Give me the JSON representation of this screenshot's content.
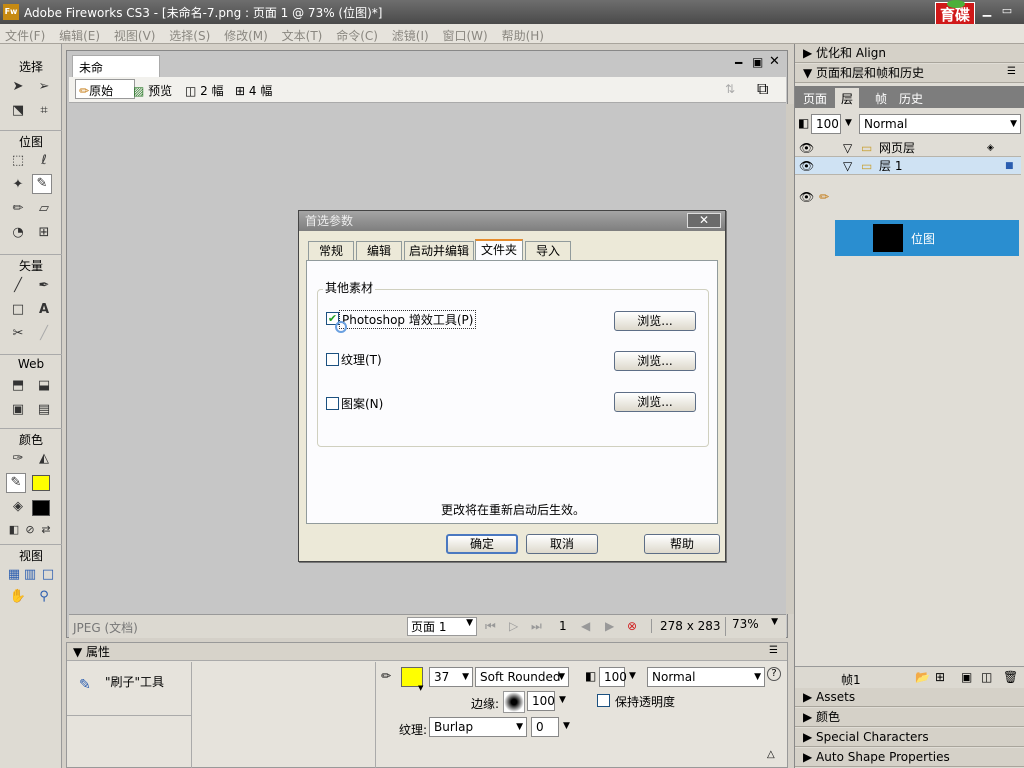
{
  "window": {
    "title": "Adobe Fireworks CS3 - [未命名-7.png : 页面 1 @ 73% (位图)*]",
    "app_icon": "Fw",
    "logo_text": "育碟\n软件"
  },
  "menu": [
    "文件(F)",
    "编辑(E)",
    "视图(V)",
    "选择(S)",
    "修改(M)",
    "文本(T)",
    "命令(C)",
    "滤镜(I)",
    "窗口(W)",
    "帮助(H)"
  ],
  "tools": {
    "sections": {
      "select": "选择",
      "bitmap": "位图",
      "vector": "矢量",
      "web": "Web",
      "color": "颜色",
      "view": "视图"
    },
    "stroke_color": "#000000",
    "fill_color": "#ffff00"
  },
  "document": {
    "tab": "未命名-7.png*",
    "views": {
      "original": "原始",
      "preview": "预览",
      "two_up": "2 幅",
      "four_up": "4 幅"
    },
    "status": {
      "format": "JPEG (文档)",
      "page": "页面 1",
      "frame": "1",
      "size": "278 x 283",
      "zoom": "73%"
    },
    "canvas_color": "#c6c6c6"
  },
  "dialog": {
    "title": "首选参数",
    "tabs": [
      "常规",
      "编辑",
      "启动并编辑",
      "文件夹",
      "导入"
    ],
    "active_tab": "文件夹",
    "group": "其他素材",
    "items": [
      {
        "label": "Photoshop 增效工具(P)",
        "checked": true,
        "button": "浏览..."
      },
      {
        "label": "纹理(T)",
        "checked": false,
        "button": "浏览..."
      },
      {
        "label": "图案(N)",
        "checked": false,
        "button": "浏览..."
      }
    ],
    "note": "更改将在重新启动后生效。",
    "buttons": {
      "ok": "确定",
      "cancel": "取消",
      "help": "帮助"
    }
  },
  "properties": {
    "title": "属性",
    "tool": "\"刷子\"工具",
    "stroke_size": "37",
    "stroke_type": "Soft Rounded",
    "edge_label": "边缘:",
    "edge_value": "100",
    "texture_label": "纹理:",
    "texture": "Burlap",
    "texture_amount": "0",
    "opacity": "100",
    "blend": "Normal",
    "preserve": "保持透明度",
    "stroke_color": "#ffff00"
  },
  "right_panel": {
    "optimize": "优化和 Align",
    "pages_group": "页面和层和帧和历史",
    "tabs": [
      "页面",
      "层",
      "帧",
      "历史"
    ],
    "active_tab": "层",
    "opacity": "100",
    "blend": "Normal",
    "web_layer": "网页层",
    "layer1": "层 1",
    "bitmap": "位图",
    "frame": "帧1",
    "collapsed": [
      "Assets",
      "颜色",
      "Special Characters",
      "Auto Shape Properties"
    ]
  }
}
